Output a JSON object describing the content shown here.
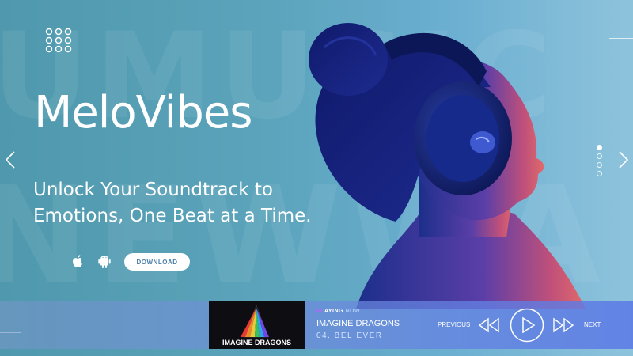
{
  "background": {
    "word_top": "UMUSIC",
    "word_bottom": "NEWWA"
  },
  "hero": {
    "brand": "MeloVibes",
    "tagline": "Unlock Your Soundtrack to Emotions, One Beat at a Time.",
    "download_label": "DOWNLOAD"
  },
  "icons": {
    "menu": "grid-menu-icon",
    "prev_slide": "chevron-left-icon",
    "next_slide": "chevron-right-icon",
    "apple": "apple-icon",
    "android": "android-icon"
  },
  "slider": {
    "count": 4,
    "active_index": 0
  },
  "player": {
    "now_playing_prefix": "PL",
    "now_playing_mid": "AYING",
    "now_playing_suffix": "NOW",
    "artist": "IMAGINE DRAGONS",
    "track": "04. BELIEVER",
    "album_text": "IMAGINE DRAGONS",
    "previous_label": "PREVIOUS",
    "next_label": "NEXT"
  },
  "colors": {
    "accent": "#4a7fa8",
    "now_playing_purple": "#c060ff"
  }
}
